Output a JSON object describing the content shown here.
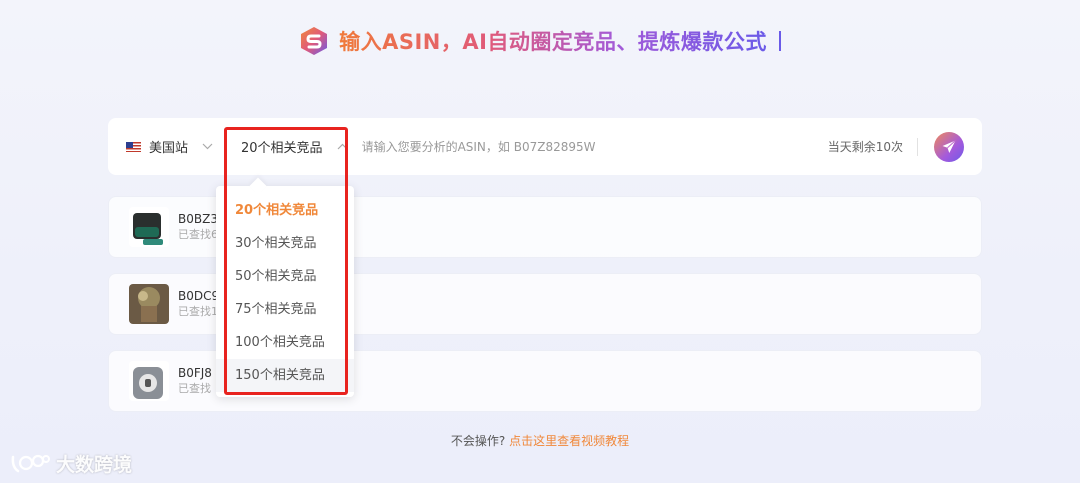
{
  "header": {
    "title": "输入ASIN，AI自动圈定竞品、提炼爆款公式"
  },
  "search": {
    "site": "美国站",
    "count_selected": "20个相关竞品",
    "placeholder": "请输入您要分析的ASIN，如 B07Z82895W",
    "remaining": "当天剩余10次"
  },
  "dropdown": {
    "items": [
      "20个相关竞品",
      "30个相关竞品",
      "50个相关竞品",
      "75个相关竞品",
      "100个相关竞品",
      "150个相关竞品"
    ],
    "selected_index": 0,
    "hovered_index": 5
  },
  "results": [
    {
      "asin": "B0BZ3",
      "sub": "已查找6"
    },
    {
      "asin": "B0DC9",
      "sub": "已查找1"
    },
    {
      "asin": "B0FJ8",
      "sub": "已查找"
    }
  ],
  "footer": {
    "question": "不会操作?",
    "link": "点击这里查看视频教程"
  },
  "watermark": {
    "text": "大数跨境"
  },
  "colors": {
    "accent": "#f0883a",
    "highlight_box": "#e8231f",
    "brand_purple": "#6a5ae8"
  },
  "icons": {
    "logo": "s-logo-icon",
    "flag": "us-flag-icon",
    "chevron": "chevron-down-icon",
    "send": "paper-plane-icon"
  }
}
